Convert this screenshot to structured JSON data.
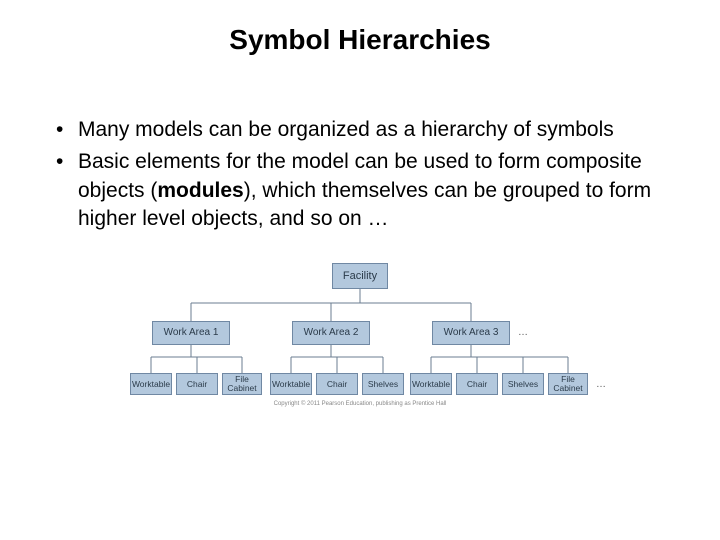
{
  "title": "Symbol Hierarchies",
  "bullets": {
    "item1": "Many models can be organized as a hierarchy of symbols",
    "item2_pre": "Basic elements for the model can be used to form composite objects (",
    "item2_bold": "modules",
    "item2_post": "), which themselves can be grouped to form higher level objects, and so on …"
  },
  "diagram": {
    "root": "Facility",
    "level2": {
      "a": "Work Area 1",
      "b": "Work Area 2",
      "c": "Work Area 3"
    },
    "group1": {
      "a": "Worktable",
      "b": "Chair",
      "c": "File\nCabinet"
    },
    "group2": {
      "a": "Worktable",
      "b": "Chair",
      "c": "Shelves"
    },
    "group3": {
      "a": "Worktable",
      "b": "Chair",
      "c": "Shelves",
      "d": "File\nCabinet"
    },
    "ellipsis": "…",
    "copyright": "Copyright © 2011 Pearson Education, publishing as Prentice Hall"
  }
}
